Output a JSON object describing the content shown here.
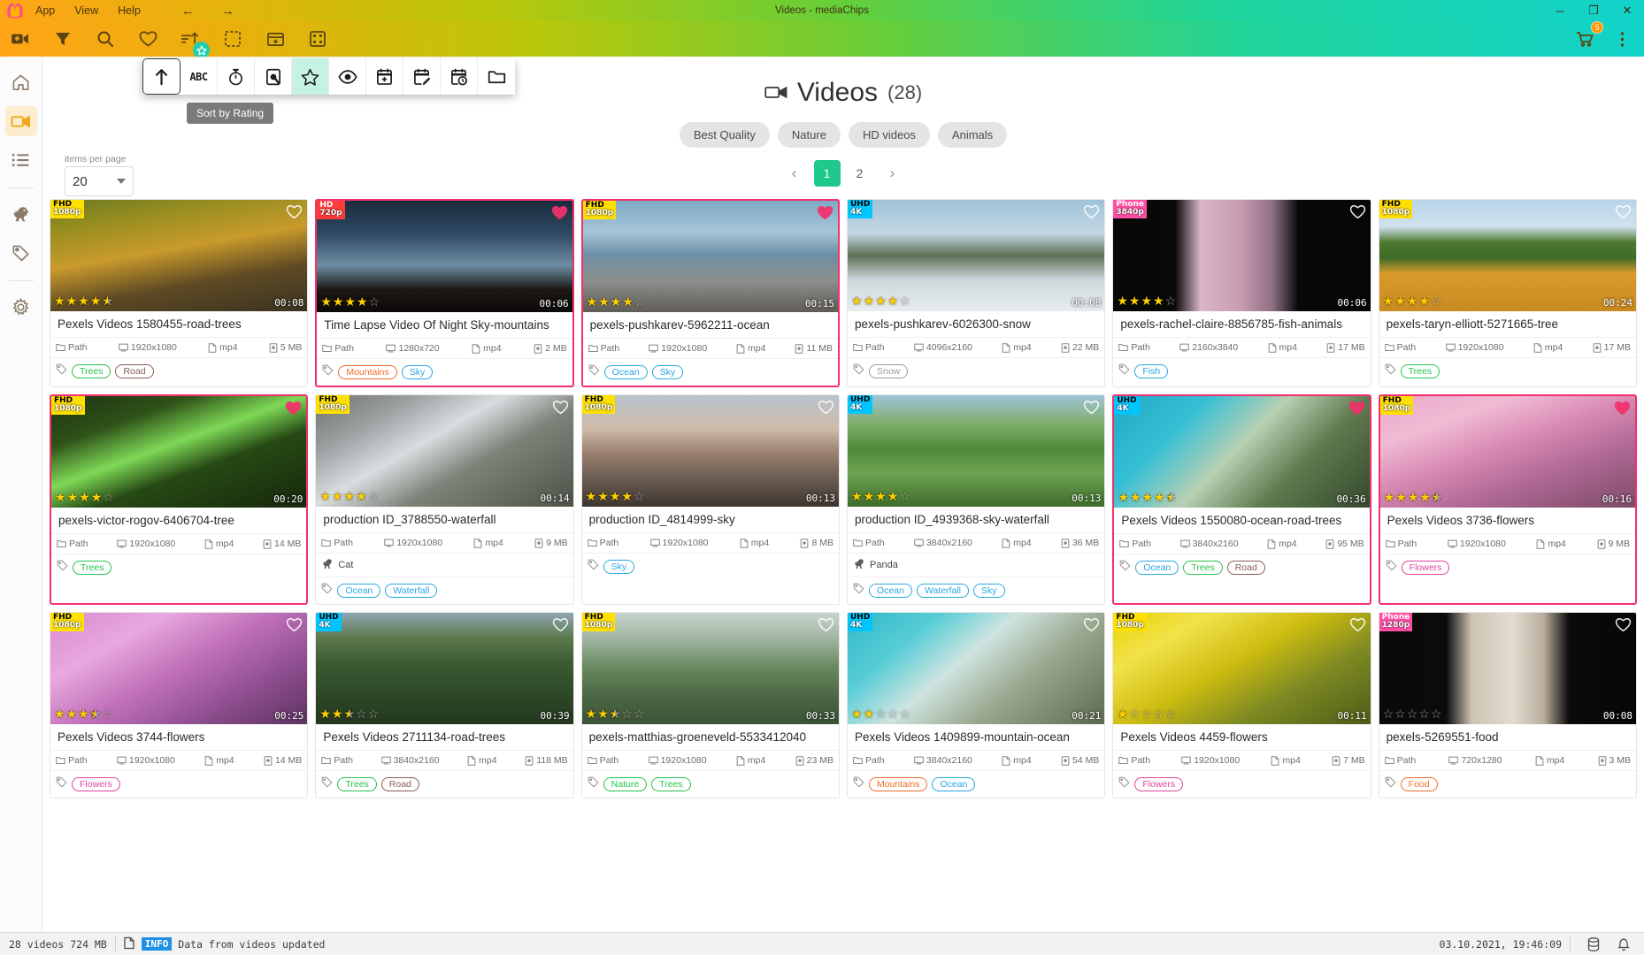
{
  "window": {
    "title": "Videos - mediaChips",
    "menu": [
      "App",
      "View",
      "Help"
    ],
    "nav_back": "←",
    "nav_forward": "→",
    "minimize": "─",
    "maximize": "❐",
    "close": "✕"
  },
  "toolbar": {
    "buttons": [
      {
        "name": "add-video-icon",
        "label": "Add video"
      },
      {
        "name": "filter-icon",
        "label": "Filter"
      },
      {
        "name": "search-icon",
        "label": "Search"
      },
      {
        "name": "favorites-icon",
        "label": "Favorites"
      },
      {
        "name": "sort-icon",
        "label": "Sort by Rating"
      },
      {
        "name": "select-icon",
        "label": "Select"
      },
      {
        "name": "add-panel-icon",
        "label": "Add panel"
      },
      {
        "name": "grid-icon",
        "label": "Layout"
      }
    ],
    "cart_badge": "5"
  },
  "sidebar": {
    "items": [
      {
        "name": "sidebar-item-home",
        "icon": "home-icon",
        "active": false
      },
      {
        "name": "sidebar-item-videos",
        "icon": "video-camera-icon",
        "active": true
      },
      {
        "name": "sidebar-item-playlists",
        "icon": "list-icon",
        "active": false
      },
      {
        "name": "sidebar-item-dino",
        "icon": "dinosaur-icon",
        "active": false
      },
      {
        "name": "sidebar-item-tags",
        "icon": "tag-icon",
        "active": false
      },
      {
        "name": "sidebar-item-settings",
        "icon": "gear-icon",
        "active": false
      }
    ]
  },
  "sort_popup": {
    "tooltip": "Sort by Rating",
    "buttons": [
      {
        "name": "sort-direction-asc-button",
        "icon": "arrow-up-icon",
        "selected": false,
        "boxed": true
      },
      {
        "name": "sort-by-name-button",
        "icon": "abc-icon",
        "label": "ABC",
        "selected": false
      },
      {
        "name": "sort-by-duration-button",
        "icon": "stopwatch-icon",
        "selected": false
      },
      {
        "name": "sort-by-size-button",
        "icon": "harddisk-icon",
        "selected": false
      },
      {
        "name": "sort-by-rating-button",
        "icon": "star-icon",
        "selected": true
      },
      {
        "name": "sort-by-views-button",
        "icon": "eye-icon",
        "selected": false
      },
      {
        "name": "sort-by-date-added-button",
        "icon": "calendar-plus-icon",
        "selected": false
      },
      {
        "name": "sort-by-date-edited-button",
        "icon": "calendar-edit-icon",
        "selected": false
      },
      {
        "name": "sort-by-date-viewed-button",
        "icon": "calendar-clock-icon",
        "selected": false
      },
      {
        "name": "sort-by-folder-button",
        "icon": "folder-icon",
        "selected": false
      }
    ]
  },
  "header": {
    "title": "Videos",
    "count": "(28)",
    "icon": "video-camera-icon",
    "chips": [
      "Best Quality",
      "Nature",
      "HD videos",
      "Animals"
    ]
  },
  "items_per_page": {
    "label": "items per page",
    "value": "20"
  },
  "pager": {
    "prev": "‹",
    "next": "›",
    "pages": [
      "1",
      "2"
    ],
    "current": "1"
  },
  "colors": {
    "accent_green": "#1fc98b",
    "favorite_pink": "#f3306c",
    "info_blue": "#1e90e8",
    "sidebar_active": "#f0a81e"
  },
  "cards": [
    {
      "title": "Pexels Videos 1580455-road-trees",
      "res_label": "FHD",
      "res_sub": "1080p",
      "res_class": "res-fhd",
      "resolution": "1920x1080",
      "format": "mp4",
      "size": "5 MB",
      "path": "Path",
      "duration": "00:08",
      "rating": 4.5,
      "favorite": false,
      "tags": [
        {
          "label": "Trees",
          "color": "#27c24c"
        },
        {
          "label": "Road",
          "color": "#8b5a52"
        }
      ],
      "person": null,
      "img": "linear-gradient(170deg,#6d7a22 0%,#9a8f20 22%,#c99a2c 45%,#5e4a23 70%,#3b3322 100%)"
    },
    {
      "title": "Time Lapse Video Of Night Sky-mountains",
      "res_label": "HD",
      "res_sub": "720p",
      "res_class": "res-hd",
      "resolution": "1280x720",
      "format": "mp4",
      "size": "2 MB",
      "path": "Path",
      "duration": "00:06",
      "rating": 4,
      "favorite": true,
      "tags": [
        {
          "label": "Mountains",
          "color": "#ef6c29"
        },
        {
          "label": "Sky",
          "color": "#29a7e0"
        }
      ],
      "person": null,
      "img": "linear-gradient(180deg,#1a2b3c 0%,#2e4a63 30%,#6e8ea3 58%,#1b1714 80%,#0c0a09 100%)"
    },
    {
      "title": "pexels-pushkarev-5962211-ocean",
      "res_label": "FHD",
      "res_sub": "1080p",
      "res_class": "res-fhd",
      "resolution": "1920x1080",
      "format": "mp4",
      "size": "11 MB",
      "path": "Path",
      "duration": "00:15",
      "rating": 4,
      "favorite": true,
      "tags": [
        {
          "label": "Ocean",
          "color": "#29a7e0"
        },
        {
          "label": "Sky",
          "color": "#29a7e0"
        }
      ],
      "person": null,
      "img": "linear-gradient(180deg,#7ea8c4 0%,#a8c6d8 28%,#6c8fa6 48%,#8d8f8c 72%,#5f5c56 100%)"
    },
    {
      "title": "pexels-pushkarev-6026300-snow",
      "res_label": "UHD",
      "res_sub": "4K",
      "res_class": "res-uhd",
      "resolution": "4096x2160",
      "format": "mp4",
      "size": "22 MB",
      "path": "Path",
      "duration": "00:08",
      "rating": 4,
      "favorite": false,
      "tags": [
        {
          "label": "Snow",
          "color": "#9a9a9a"
        }
      ],
      "person": null,
      "img": "linear-gradient(180deg,#9fc2d8 0%,#c3d8e4 30%,#5e6f56 50%,#cfd8dc 72%,#e7edef 100%)"
    },
    {
      "title": "pexels-rachel-claire-8856785-fish-animals",
      "res_label": "Phone",
      "res_sub": "3840p",
      "res_class": "res-phone",
      "resolution": "2160x3840",
      "format": "mp4",
      "size": "17 MB",
      "path": "Path",
      "duration": "00:06",
      "rating": 4,
      "favorite": false,
      "tags": [
        {
          "label": "Fish",
          "color": "#29a7e0"
        }
      ],
      "person": null,
      "img": "linear-gradient(90deg,#070707 0%,#090909 24%,#d9b7c8 34%,#c89ab0 50%,#8d6f82 62%,#080808 72%,#060606 100%)"
    },
    {
      "title": "pexels-taryn-elliott-5271665-tree",
      "res_label": "FHD",
      "res_sub": "1080p",
      "res_class": "res-fhd",
      "resolution": "1920x1080",
      "format": "mp4",
      "size": "17 MB",
      "path": "Path",
      "duration": "00:24",
      "rating": 4,
      "favorite": false,
      "tags": [
        {
          "label": "Trees",
          "color": "#27c24c"
        }
      ],
      "person": null,
      "img": "linear-gradient(180deg,#b8d4e8 0%,#cfe2ee 24%,#4e7a2f 38%,#3d6b28 52%,#d99a2a 66%,#c98a22 100%)"
    },
    {
      "title": "pexels-victor-rogov-6406704-tree",
      "res_label": "FHD",
      "res_sub": "1080p",
      "res_class": "res-fhd",
      "resolution": "1920x1080",
      "format": "mp4",
      "size": "14 MB",
      "path": "Path",
      "duration": "00:20",
      "rating": 4,
      "favorite": true,
      "tags": [
        {
          "label": "Trees",
          "color": "#27c24c"
        }
      ],
      "person": null,
      "img": "linear-gradient(160deg,#1d3311 0%,#2f5218 25%,#7ed957 45%,#274a14 62%,#16280c 100%)"
    },
    {
      "title": "production ID_3788550-waterfall",
      "res_label": "FHD",
      "res_sub": "1080p",
      "res_class": "res-fhd",
      "resolution": "1920x1080",
      "format": "mp4",
      "size": "9 MB",
      "path": "Path",
      "duration": "00:14",
      "rating": 4,
      "favorite": false,
      "tags": [
        {
          "label": "Ocean",
          "color": "#29a7e0"
        },
        {
          "label": "Waterfall",
          "color": "#29a7e0"
        }
      ],
      "person": "Cat",
      "img": "linear-gradient(150deg,#6f706a 0%,#9aa0a0 22%,#d8dee0 42%,#7d8379 62%,#4e5348 100%)"
    },
    {
      "title": "production ID_4814999-sky",
      "res_label": "FHD",
      "res_sub": "1080p",
      "res_class": "res-fhd",
      "resolution": "1920x1080",
      "format": "mp4",
      "size": "8 MB",
      "path": "Path",
      "duration": "00:13",
      "rating": 4,
      "favorite": false,
      "tags": [
        {
          "label": "Sky",
          "color": "#29a7e0"
        }
      ],
      "person": null,
      "img": "linear-gradient(180deg,#b9c3cc 0%,#cdbba8 30%,#9b7f6e 52%,#6b5d52 74%,#3e362f 100%)"
    },
    {
      "title": "production ID_4939368-sky-waterfall",
      "res_label": "UHD",
      "res_sub": "4K",
      "res_class": "res-uhd",
      "resolution": "3840x2160",
      "format": "mp4",
      "size": "36 MB",
      "path": "Path",
      "duration": "00:13",
      "rating": 4,
      "favorite": false,
      "tags": [
        {
          "label": "Ocean",
          "color": "#29a7e0"
        },
        {
          "label": "Waterfall",
          "color": "#29a7e0"
        },
        {
          "label": "Sky",
          "color": "#29a7e0"
        }
      ],
      "person": "Panda",
      "img": "linear-gradient(180deg,#9fc3d8 0%,#7fae6a 26%,#4e8a3a 48%,#6fa352 70%,#3d6b2c 100%)"
    },
    {
      "title": "Pexels Videos 1550080-ocean-road-trees",
      "res_label": "UHD",
      "res_sub": "4K",
      "res_class": "res-uhd",
      "resolution": "3840x2160",
      "format": "mp4",
      "size": "95 MB",
      "path": "Path",
      "duration": "00:36",
      "rating": 4.5,
      "favorite": true,
      "tags": [
        {
          "label": "Ocean",
          "color": "#29a7e0"
        },
        {
          "label": "Trees",
          "color": "#27c24c"
        },
        {
          "label": "Road",
          "color": "#8b5a52"
        }
      ],
      "person": null,
      "img": "linear-gradient(135deg,#1fa8c4 0%,#36c0d6 26%,#b9cfb2 48%,#5e7a4e 70%,#35492c 100%)"
    },
    {
      "title": "Pexels Videos 3736-flowers",
      "res_label": "FHD",
      "res_sub": "1080p",
      "res_class": "res-fhd",
      "resolution": "1920x1080",
      "format": "mp4",
      "size": "9 MB",
      "path": "Path",
      "duration": "00:16",
      "rating": 4.5,
      "favorite": true,
      "tags": [
        {
          "label": "Flowers",
          "color": "#e0439c"
        }
      ],
      "person": null,
      "img": "linear-gradient(160deg,#e8a8c8 0%,#f0bcd4 24%,#d98ab4 46%,#b06a94 68%,#7d4a6a 100%)"
    },
    {
      "title": "Pexels Videos 3744-flowers",
      "res_label": "FHD",
      "res_sub": "1080p",
      "res_class": "res-fhd",
      "resolution": "1920x1080",
      "format": "mp4",
      "size": "14 MB",
      "path": "Path",
      "duration": "00:25",
      "rating": 3.5,
      "favorite": false,
      "tags": [
        {
          "label": "Flowers",
          "color": "#e0439c"
        }
      ],
      "person": null,
      "img": "linear-gradient(150deg,#d88ad0 0%,#e8a8de 26%,#c070b8 50%,#8f4f90 74%,#5e3362 100%)"
    },
    {
      "title": "Pexels Videos 2711134-road-trees",
      "res_label": "UHD",
      "res_sub": "4K",
      "res_class": "res-uhd",
      "resolution": "3840x2160",
      "format": "mp4",
      "size": "118 MB",
      "path": "Path",
      "duration": "00:39",
      "rating": 2.5,
      "favorite": false,
      "tags": [
        {
          "label": "Trees",
          "color": "#27c24c"
        },
        {
          "label": "Road",
          "color": "#8b5a52"
        }
      ],
      "person": null,
      "img": "linear-gradient(180deg,#8fa6b4 0%,#5c7a4c 22%,#3c5a33 46%,#2e4a28 70%,#23381f 100%)"
    },
    {
      "title": "pexels-matthias-groeneveld-5533412040",
      "res_label": "FHD",
      "res_sub": "1080p",
      "res_class": "res-fhd",
      "resolution": "1920x1080",
      "format": "mp4",
      "size": "23 MB",
      "path": "Path",
      "duration": "00:33",
      "rating": 2.5,
      "favorite": false,
      "tags": [
        {
          "label": "Nature",
          "color": "#27c24c"
        },
        {
          "label": "Trees",
          "color": "#27c24c"
        }
      ],
      "person": null,
      "img": "linear-gradient(180deg,#c8d4cf 0%,#9fb49f 24%,#6a8a60 48%,#4e6a46 72%,#3a5236 100%)"
    },
    {
      "title": "Pexels Videos 1409899-mountain-ocean",
      "res_label": "UHD",
      "res_sub": "4K",
      "res_class": "res-uhd",
      "resolution": "3840x2160",
      "format": "mp4",
      "size": "54 MB",
      "path": "Path",
      "duration": "00:21",
      "rating": 2,
      "favorite": false,
      "tags": [
        {
          "label": "Mountains",
          "color": "#ef6c29"
        },
        {
          "label": "Ocean",
          "color": "#29a7e0"
        }
      ],
      "person": null,
      "img": "linear-gradient(140deg,#2fb8c8 0%,#57cdd6 24%,#cfe4e0 44%,#9aa88f 66%,#5e6a50 100%)"
    },
    {
      "title": "Pexels Videos 4459-flowers",
      "res_label": "FHD",
      "res_sub": "1080p",
      "res_class": "res-fhd",
      "resolution": "1920x1080",
      "format": "mp4",
      "size": "7 MB",
      "path": "Path",
      "duration": "00:11",
      "rating": 1,
      "favorite": false,
      "tags": [
        {
          "label": "Flowers",
          "color": "#e0439c"
        }
      ],
      "person": null,
      "img": "linear-gradient(150deg,#e8d400 0%,#f2e24a 22%,#cdbc10 46%,#7d8a22 70%,#4e5a18 100%)"
    },
    {
      "title": "pexels-5269551-food",
      "res_label": "Phone",
      "res_sub": "1280p",
      "res_class": "res-phone",
      "resolution": "720x1280",
      "format": "mp4",
      "size": "3 MB",
      "path": "Path",
      "duration": "00:08",
      "rating": 0,
      "favorite": false,
      "tags": [
        {
          "label": "Food",
          "color": "#ef6c29"
        }
      ],
      "person": null,
      "img": "linear-gradient(90deg,#0a0a0a 0%,#0b0b0b 26%,#cfc4b4 36%,#e4dcd0 52%,#b8ac9c 64%,#0a0a0a 74%,#070707 100%)"
    }
  ],
  "statusbar": {
    "count_text": "28 videos 724 MB",
    "info_badge": "INFO",
    "info_text": "Data from videos updated",
    "timestamp": "03.10.2021, 19:46:09",
    "db_icon": "database-icon",
    "bell_icon": "bell-icon"
  }
}
